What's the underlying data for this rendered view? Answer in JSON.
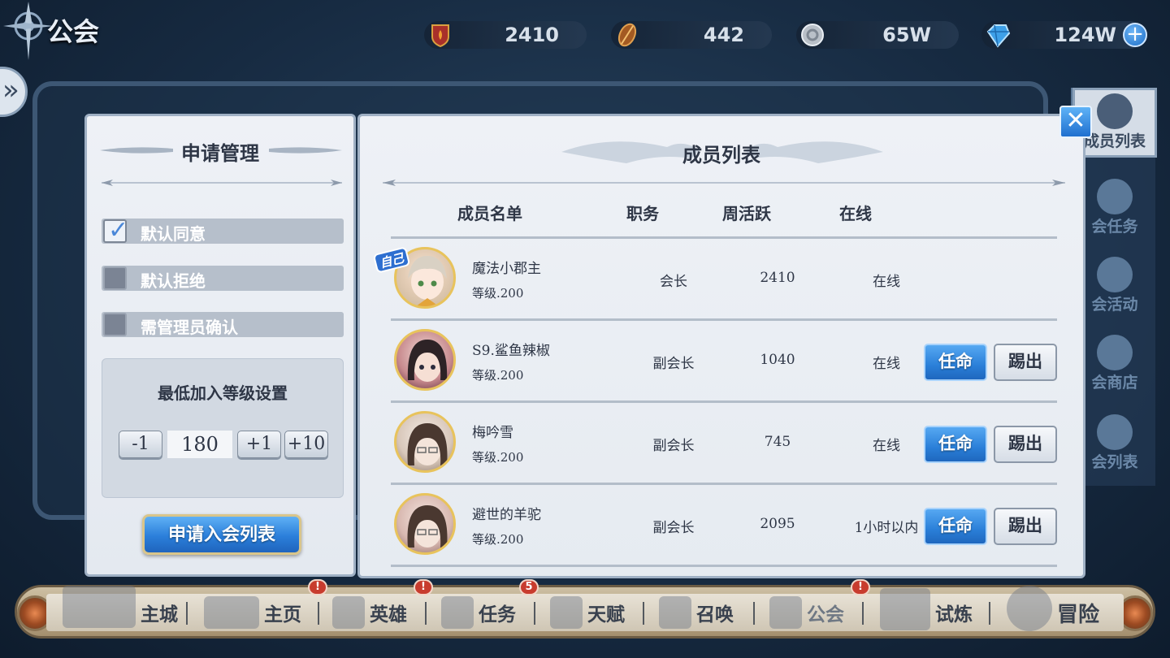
{
  "header": {
    "title": "公会",
    "resources": [
      {
        "icon": "guild-shield-icon",
        "value": "2410"
      },
      {
        "icon": "feather-token-icon",
        "value": "442"
      },
      {
        "icon": "silver-coin-icon",
        "value": "65W"
      },
      {
        "icon": "blue-gem-icon",
        "value": "124W"
      }
    ],
    "plus_label": "+"
  },
  "right_menu": [
    {
      "label": "成员列表",
      "active": true
    },
    {
      "label": "会任务"
    },
    {
      "label": "会活动"
    },
    {
      "label": "会商店"
    },
    {
      "label": "会列表"
    }
  ],
  "apply_panel": {
    "title": "申请管理",
    "options": [
      {
        "label": "默认同意",
        "checked": true
      },
      {
        "label": "默认拒绝",
        "checked": false
      },
      {
        "label": "需管理员确认",
        "checked": false
      }
    ],
    "level_setting": {
      "title": "最低加入等级设置",
      "minus_label": "-1",
      "value": "180",
      "plus1_label": "+1",
      "plus10_label": "+10"
    },
    "apply_list_button": "申请入会列表"
  },
  "member_panel": {
    "title": "成员列表",
    "headers": {
      "name": "成员名单",
      "role": "职务",
      "weekly": "周活跃",
      "online": "在线"
    },
    "self_tag": "自己",
    "appoint_label": "任命",
    "kick_label": "踢出",
    "members": [
      {
        "name": "魔法小郡主",
        "level": "等级.200",
        "role": "会长",
        "weekly": "2410",
        "online": "在线",
        "self": true
      },
      {
        "name": "S9.鲨鱼辣椒",
        "level": "等级.200",
        "role": "副会长",
        "weekly": "1040",
        "online": "在线"
      },
      {
        "name": "梅吟雪",
        "level": "等级.200",
        "role": "副会长",
        "weekly": "745",
        "online": "在线"
      },
      {
        "name": "避世的羊驼",
        "level": "等级.200",
        "role": "副会长",
        "weekly": "2095",
        "online": "1小时以内"
      }
    ]
  },
  "close_label": "✕",
  "bottom_nav": [
    {
      "label": "主城",
      "icon": "castle-icon"
    },
    {
      "label": "主页",
      "icon": "home-board-icon",
      "badge": "!"
    },
    {
      "label": "英雄",
      "icon": "hero-emblem-icon",
      "badge": "!"
    },
    {
      "label": "任务",
      "icon": "quest-scroll-icon",
      "badge": "5"
    },
    {
      "label": "天赋",
      "icon": "talent-icon"
    },
    {
      "label": "召唤",
      "icon": "summon-icon"
    },
    {
      "label": "公会",
      "icon": "guild-icon",
      "badge": "!"
    },
    {
      "label": "试炼",
      "icon": "trial-icon"
    },
    {
      "label": "冒险",
      "icon": "adventure-gear-icon"
    }
  ],
  "colors": {
    "accent_blue": "#2a7fd8",
    "panel_bg": "#eef1f6",
    "badge_red": "#c83c2e"
  }
}
